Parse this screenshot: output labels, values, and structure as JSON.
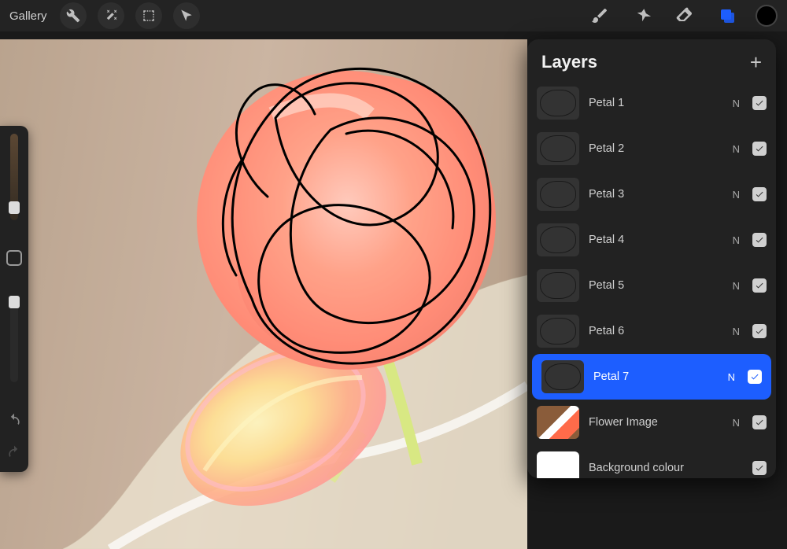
{
  "header": {
    "gallery_label": "Gallery"
  },
  "layers_panel": {
    "title": "Layers",
    "add_symbol": "+"
  },
  "layers": [
    {
      "name": "Petal 1",
      "blend": "N",
      "visible": true,
      "selected": false,
      "thumb": "sketch"
    },
    {
      "name": "Petal 2",
      "blend": "N",
      "visible": true,
      "selected": false,
      "thumb": "sketch"
    },
    {
      "name": "Petal 3",
      "blend": "N",
      "visible": true,
      "selected": false,
      "thumb": "sketch"
    },
    {
      "name": "Petal 4",
      "blend": "N",
      "visible": true,
      "selected": false,
      "thumb": "sketch"
    },
    {
      "name": "Petal 5",
      "blend": "N",
      "visible": true,
      "selected": false,
      "thumb": "sketch"
    },
    {
      "name": "Petal 6",
      "blend": "N",
      "visible": true,
      "selected": false,
      "thumb": "sketch"
    },
    {
      "name": "Petal 7",
      "blend": "N",
      "visible": true,
      "selected": true,
      "thumb": "sketch"
    },
    {
      "name": "Flower Image",
      "blend": "N",
      "visible": true,
      "selected": false,
      "thumb": "image"
    },
    {
      "name": "Background colour",
      "blend": "",
      "visible": true,
      "selected": false,
      "thumb": "white"
    }
  ],
  "colors": {
    "accent": "#1d5eff",
    "current_color": "#000000"
  }
}
